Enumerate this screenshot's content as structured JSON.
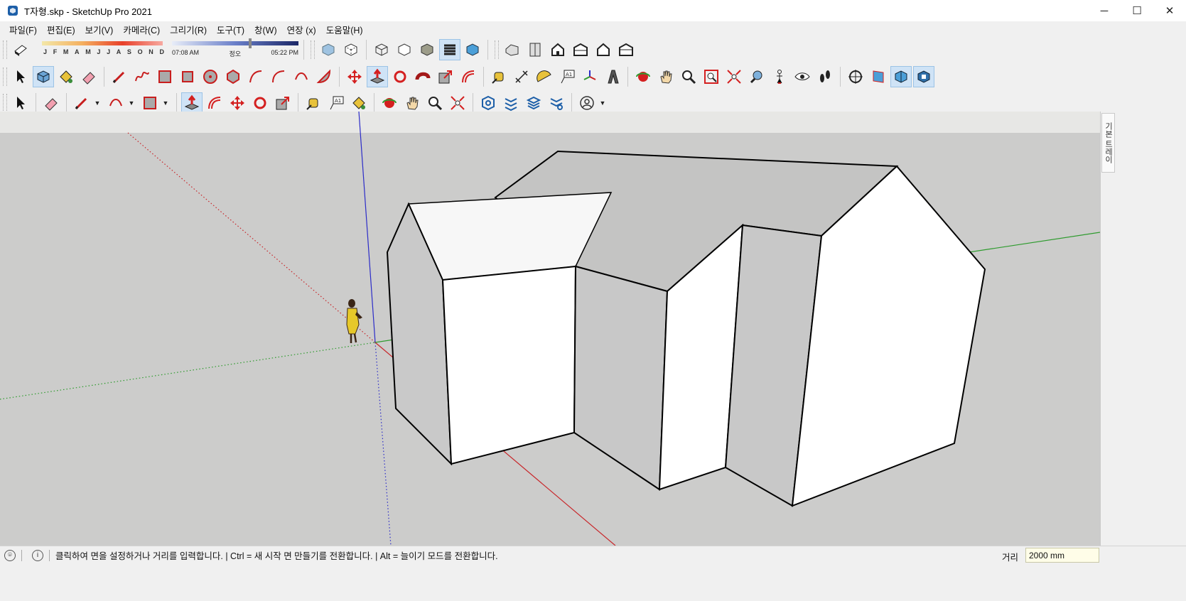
{
  "window": {
    "title": "T자형.skp - SketchUp Pro 2021",
    "controls": [
      "─",
      "☐",
      "✕"
    ]
  },
  "menu": [
    "파일(F)",
    "편집(E)",
    "보기(V)",
    "카메라(C)",
    "그리기(R)",
    "도구(T)",
    "창(W)",
    "연장 (x)",
    "도움말(H)"
  ],
  "shadows": {
    "months": [
      "J",
      "F",
      "M",
      "A",
      "M",
      "J",
      "J",
      "A",
      "S",
      "O",
      "N",
      "D"
    ],
    "time_start": "07:08 AM",
    "time_mid": "정오",
    "time_end": "05:22 PM"
  },
  "right_tray": {
    "label": "기본 트레이"
  },
  "status": {
    "message": "클릭하여 면을 설정하거나 거리를 입력합니다. | Ctrl = 새 시작 면 만들기를 전환합니다. | Alt = 늘이기 모드를 전환합니다.",
    "vcb_label": "거리",
    "vcb_value": "2000 mm"
  },
  "colors": {
    "axis_red": "#c8262a",
    "axis_green": "#2e9b2e",
    "axis_blue": "#2b2bc8",
    "ground": "#cccccb",
    "sky": "#e7e7e5",
    "face_light": "#ffffff",
    "face_shade": "#c8c8c8",
    "roof_top": "#c2c2c2"
  }
}
